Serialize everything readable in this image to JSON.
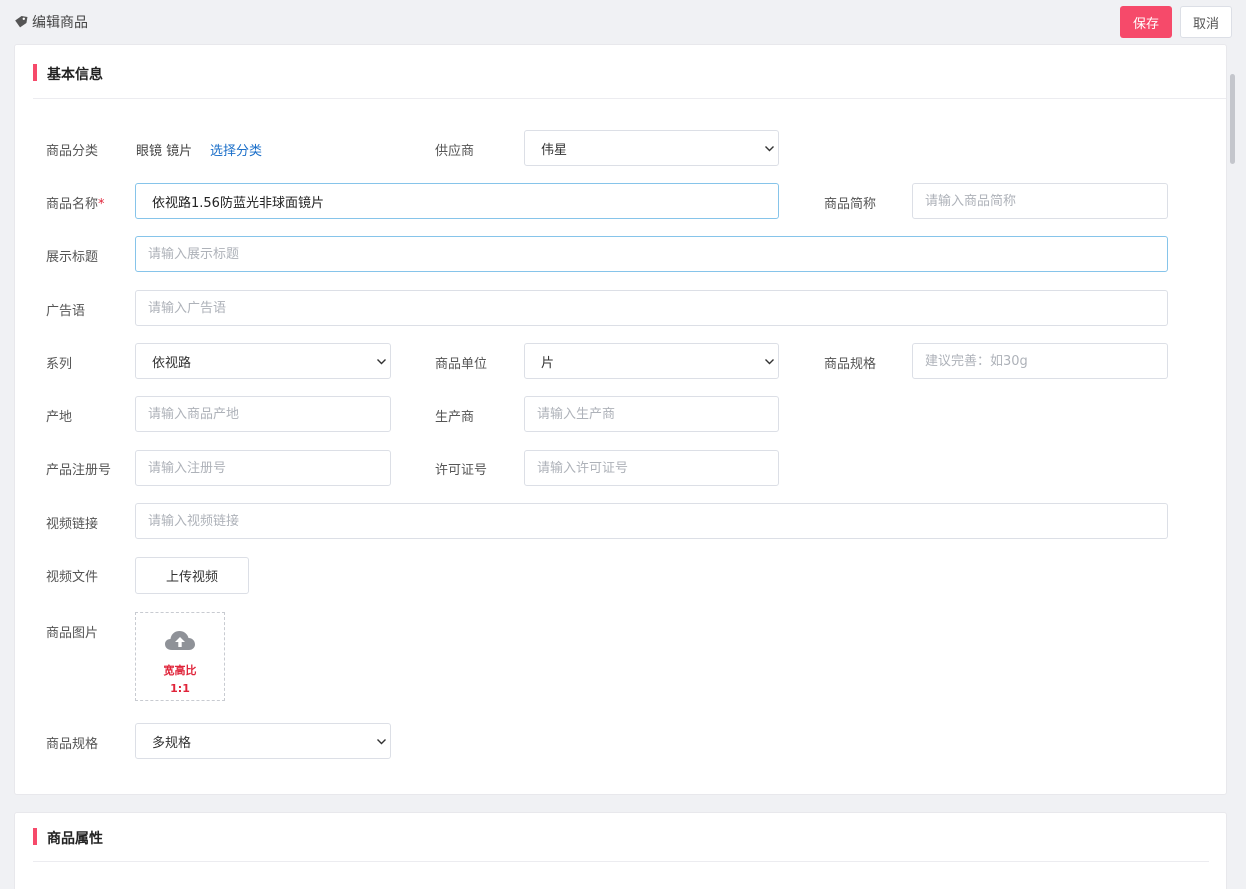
{
  "header": {
    "title": "编辑商品",
    "save_label": "保存",
    "cancel_label": "取消"
  },
  "section_basic": {
    "title": "基本信息",
    "category": {
      "label": "商品分类",
      "value": "眼镜 镜片",
      "link": "选择分类"
    },
    "supplier": {
      "label": "供应商",
      "value": "伟星"
    },
    "name": {
      "label": "商品名称",
      "required_mark": "*",
      "value": "依视路1.56防蓝光非球面镜片"
    },
    "short_name": {
      "label": "商品简称",
      "placeholder": "请输入商品简称"
    },
    "display_title": {
      "label": "展示标题",
      "placeholder": "请输入展示标题"
    },
    "ad_slogan": {
      "label": "广告语",
      "placeholder": "请输入广告语"
    },
    "series": {
      "label": "系列",
      "value": "依视路"
    },
    "unit": {
      "label": "商品单位",
      "value": "片"
    },
    "spec": {
      "label": "商品规格",
      "placeholder": "建议完善：如30g"
    },
    "origin": {
      "label": "产地",
      "placeholder": "请输入商品产地"
    },
    "manufacturer": {
      "label": "生产商",
      "placeholder": "请输入生产商"
    },
    "registration": {
      "label": "产品注册号",
      "placeholder": "请输入注册号"
    },
    "license": {
      "label": "许可证号",
      "placeholder": "请输入许可证号"
    },
    "video_link": {
      "label": "视频链接",
      "placeholder": "请输入视频链接"
    },
    "video_file": {
      "label": "视频文件",
      "button": "上传视频"
    },
    "image": {
      "label": "商品图片",
      "hint_line1": "宽高比",
      "hint_line2": "1:1",
      "icon": "cloud-upload-icon"
    },
    "spec_type": {
      "label": "商品规格",
      "value": "多规格"
    }
  },
  "section_attributes": {
    "title": "商品属性"
  },
  "colors": {
    "accent": "#f64a6a",
    "link": "#1b6fc9",
    "focus_border": "#86c4ea"
  }
}
